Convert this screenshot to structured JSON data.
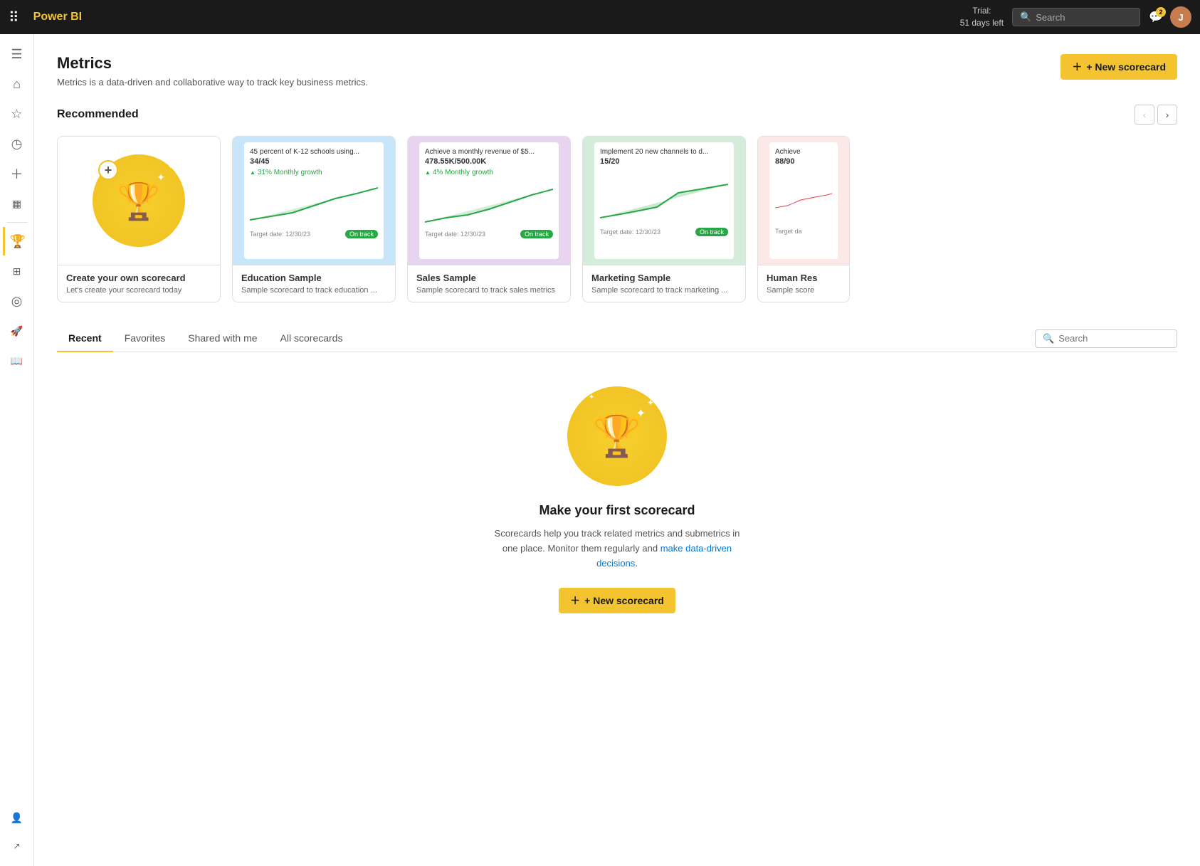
{
  "topbar": {
    "logo": "Power BI",
    "trial_line1": "Trial:",
    "trial_line2": "51 days left",
    "search_placeholder": "Search",
    "notification_count": "2"
  },
  "sidebar": {
    "items": [
      {
        "id": "menu",
        "icon": "☰",
        "label": "Menu"
      },
      {
        "id": "home",
        "icon": "⌂",
        "label": "Home"
      },
      {
        "id": "favorites",
        "icon": "☆",
        "label": "Favorites"
      },
      {
        "id": "recent",
        "icon": "◷",
        "label": "Recent"
      },
      {
        "id": "create",
        "icon": "+",
        "label": "Create"
      },
      {
        "id": "browse",
        "icon": "⬛",
        "label": "Browse"
      },
      {
        "id": "metrics",
        "icon": "🏆",
        "label": "Metrics",
        "active": true
      },
      {
        "id": "datahub",
        "icon": "▦",
        "label": "Data hub"
      },
      {
        "id": "monitor",
        "icon": "◎",
        "label": "Monitor"
      },
      {
        "id": "deploy",
        "icon": "🚀",
        "label": "Deployment pipelines"
      },
      {
        "id": "learn",
        "icon": "📖",
        "label": "Learn"
      }
    ]
  },
  "page": {
    "title": "Metrics",
    "subtitle": "Metrics is a data-driven and collaborative way to track key business metrics.",
    "new_scorecard_btn": "+ New scorecard"
  },
  "recommended": {
    "title": "Recommended",
    "cards": [
      {
        "id": "create",
        "type": "create",
        "label": "Create your own scorecard",
        "description": "Let's create your scorecard today"
      },
      {
        "id": "education",
        "type": "chart",
        "theme": "blue",
        "title": "Education Sample",
        "metric": "45 percent of K-12 schools using...",
        "value": "34/45",
        "growth": "31% Monthly growth",
        "target_date": "Target date: 12/30/23",
        "status": "On track",
        "description": "Sample scorecard to track education ..."
      },
      {
        "id": "sales",
        "type": "chart",
        "theme": "purple",
        "title": "Sales Sample",
        "metric": "Achieve a monthly revenue of $5...",
        "value": "478.55K/500.00K",
        "growth": "4% Monthly growth",
        "target_date": "Target date: 12/30/23",
        "status": "On track",
        "description": "Sample scorecard to track sales metrics"
      },
      {
        "id": "marketing",
        "type": "chart",
        "theme": "green",
        "title": "Marketing Sample",
        "metric": "Implement 20 new channels to d...",
        "value": "15/20",
        "growth": "",
        "target_date": "Target date: 12/30/23",
        "status": "On track",
        "description": "Sample scorecard to track marketing ..."
      },
      {
        "id": "human",
        "type": "chart",
        "theme": "pink",
        "title": "Human Res",
        "metric": "Achieve",
        "value": "88/90",
        "growth": "",
        "target_date": "Target da",
        "status": "",
        "description": "Sample score"
      }
    ]
  },
  "tabs": {
    "items": [
      {
        "id": "recent",
        "label": "Recent",
        "active": true
      },
      {
        "id": "favorites",
        "label": "Favorites",
        "active": false
      },
      {
        "id": "shared",
        "label": "Shared with me",
        "active": false
      },
      {
        "id": "all",
        "label": "All scorecards",
        "active": false
      }
    ],
    "search_placeholder": "Search"
  },
  "empty_state": {
    "title": "Make your first scorecard",
    "desc_part1": "Scorecards help you track related metrics and submetrics in one place. Monitor them regularly and ",
    "desc_link1": "make data-driven decisions",
    "desc_part2": ".",
    "btn_label": "+ New scorecard"
  }
}
